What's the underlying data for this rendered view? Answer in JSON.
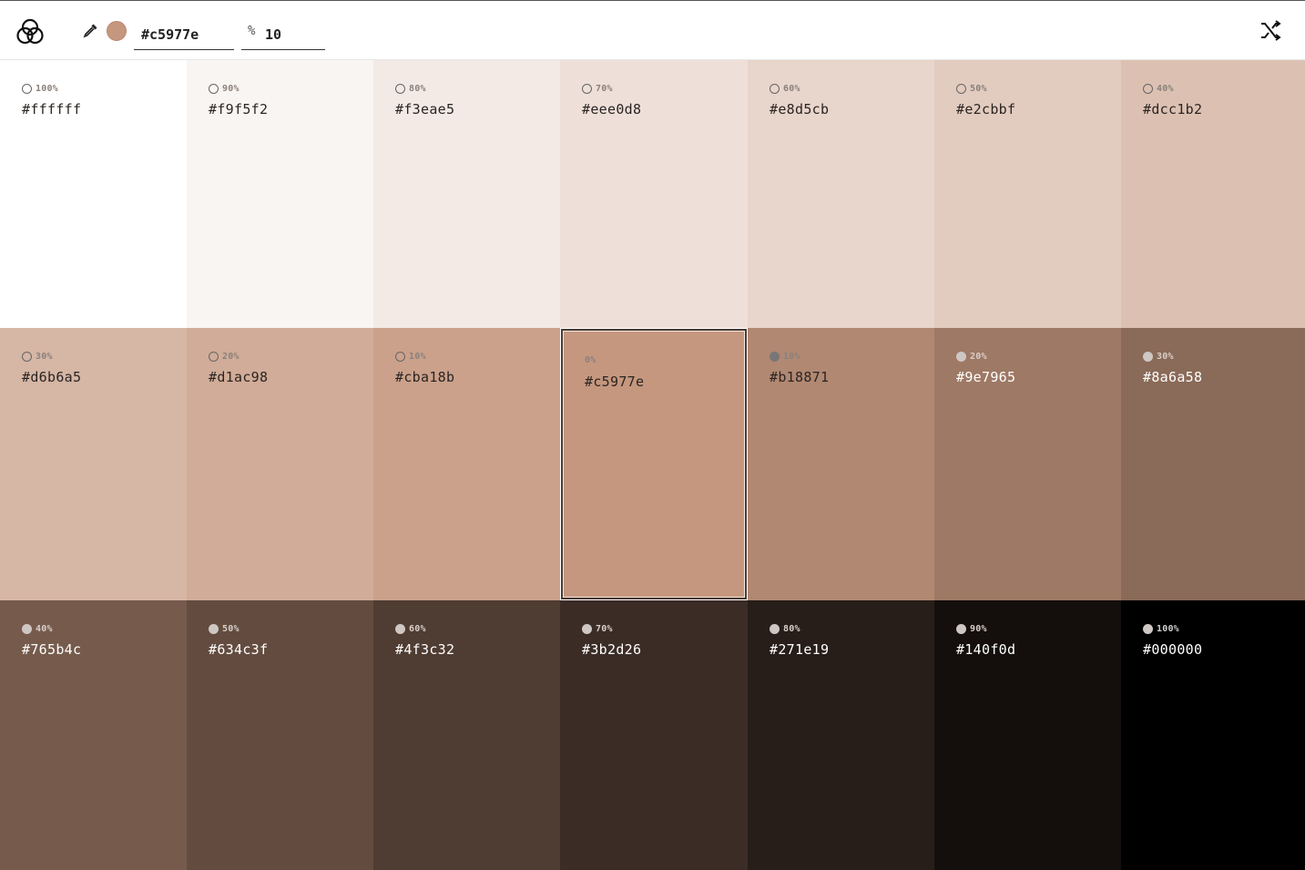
{
  "header": {
    "current_hex": "#c5977e",
    "current_color": "#c5977e",
    "percent_symbol": "%",
    "step_percent": "10",
    "icons": [
      "logo-icon",
      "eyedropper-icon",
      "shuffle-icon"
    ]
  },
  "rows": [
    [
      {
        "label": "100%",
        "hex": "#ffffff",
        "marker": "ring"
      },
      {
        "label": "90%",
        "hex": "#f9f5f2",
        "marker": "ring"
      },
      {
        "label": "80%",
        "hex": "#f3eae5",
        "marker": "ring"
      },
      {
        "label": "70%",
        "hex": "#eee0d8",
        "marker": "ring"
      },
      {
        "label": "60%",
        "hex": "#e8d5cb",
        "marker": "ring"
      },
      {
        "label": "50%",
        "hex": "#e2cbbf",
        "marker": "ring"
      },
      {
        "label": "40%",
        "hex": "#dcc1b2",
        "marker": "ring"
      }
    ],
    [
      {
        "label": "30%",
        "hex": "#d6b6a5",
        "marker": "ring"
      },
      {
        "label": "20%",
        "hex": "#d1ac98",
        "marker": "ring"
      },
      {
        "label": "10%",
        "hex": "#cba18b",
        "marker": "ring"
      },
      {
        "label": "0%",
        "hex": "#c5977e",
        "marker": "none",
        "selected": true
      },
      {
        "label": "10%",
        "hex": "#b18871",
        "marker": "dot"
      },
      {
        "label": "20%",
        "hex": "#9e7965",
        "marker": "dot"
      },
      {
        "label": "30%",
        "hex": "#8a6a58",
        "marker": "dot"
      }
    ],
    [
      {
        "label": "40%",
        "hex": "#765b4c",
        "marker": "dot"
      },
      {
        "label": "50%",
        "hex": "#634c3f",
        "marker": "dot"
      },
      {
        "label": "60%",
        "hex": "#4f3c32",
        "marker": "dot"
      },
      {
        "label": "70%",
        "hex": "#3b2d26",
        "marker": "dot"
      },
      {
        "label": "80%",
        "hex": "#271e19",
        "marker": "dot"
      },
      {
        "label": "90%",
        "hex": "#140f0d",
        "marker": "dot"
      },
      {
        "label": "100%",
        "hex": "#000000",
        "marker": "dot"
      }
    ]
  ]
}
